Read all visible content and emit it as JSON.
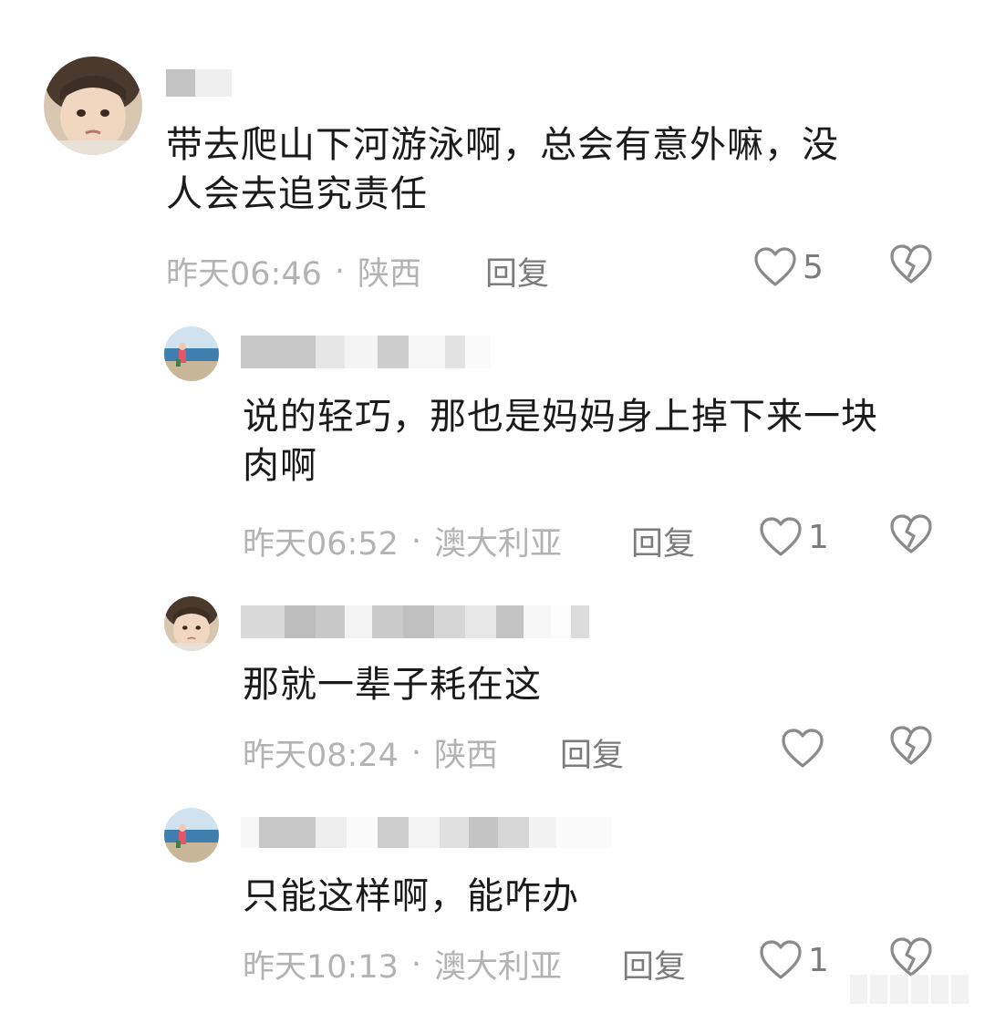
{
  "comments": [
    {
      "text": "带去爬山下河游泳啊，总会有意外嘛，没人会去追究责任",
      "line1": "带去爬山下河游泳啊，总会有意外嘛，没",
      "line2": "人会去追究责任",
      "time": "昨天06:46",
      "location": "陕西",
      "reply_label": "回复",
      "likes": "5",
      "avatar_icon": "child-face-avatar"
    },
    {
      "line1": "说的轻巧，那也是妈妈身上掉下来一块",
      "line2": "肉啊",
      "time": "昨天06:52",
      "location": "澳大利亚",
      "reply_label": "回复",
      "likes": "1",
      "avatar_icon": "beach-photo-avatar"
    },
    {
      "line1": "那就一辈子耗在这",
      "time": "昨天08:24",
      "location": "陕西",
      "reply_label": "回复",
      "likes": "",
      "avatar_icon": "child-face-avatar"
    },
    {
      "line1": "只能这样啊，能咋办",
      "time": "昨天10:13",
      "location": "澳大利亚",
      "reply_label": "回复",
      "likes": "1",
      "avatar_icon": "beach-photo-avatar"
    }
  ],
  "meta_separator": "·",
  "colors": {
    "text": "#1a1a1a",
    "meta": "#b3b3b3",
    "action": "#7c7c7c"
  }
}
